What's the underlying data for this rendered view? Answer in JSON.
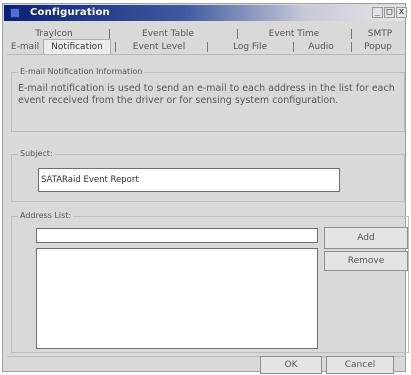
{
  "window": {
    "title": "Configuration",
    "buttons": {
      "minimize": "_",
      "maximize": "□",
      "close": "x"
    }
  },
  "tabs": {
    "row1": [
      {
        "label": "TrayIcon"
      },
      {
        "label": "Event Table"
      },
      {
        "label": "Event Time"
      },
      {
        "label": "SMTP"
      }
    ],
    "row2": [
      {
        "label": "E-mail"
      },
      {
        "label": "Notification"
      },
      {
        "label": "Event Level"
      },
      {
        "label": "Log File"
      },
      {
        "label": "Audio"
      },
      {
        "label": "Popup"
      }
    ],
    "active": "Notification"
  },
  "info": {
    "group_label": "E-mail Notification Information",
    "text": "E-mail notification is used to send an e-mail to each address in the list for each event received from the driver or for sensing system configuration."
  },
  "subject": {
    "group_label": "Subject:",
    "value": "SATARaid Event Report"
  },
  "address": {
    "group_label": "Address List:",
    "input_value": "",
    "items": [],
    "add_label": "Add",
    "remove_label": "Remove"
  },
  "footer": {
    "ok_label": "OK",
    "cancel_label": "Cancel"
  }
}
